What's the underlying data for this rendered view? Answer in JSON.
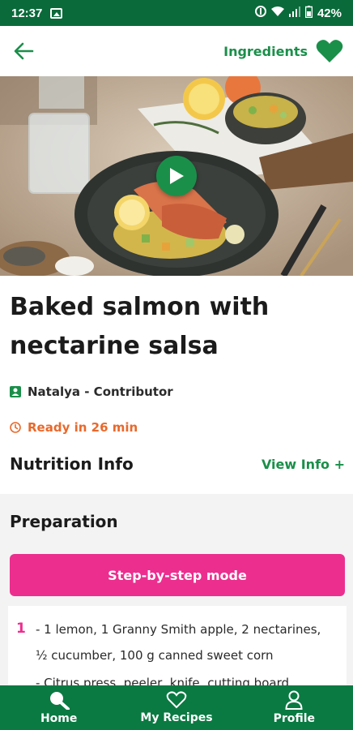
{
  "status_bar": {
    "time": "12:37",
    "battery": "42%"
  },
  "header": {
    "ingredients_label": "Ingredients"
  },
  "recipe": {
    "title": "Baked salmon with nectarine salsa",
    "author": "Natalya - Contributor",
    "ready_time": "Ready in 26 min"
  },
  "nutrition": {
    "title": "Nutrition Info",
    "view_label": "View Info +"
  },
  "preparation": {
    "title": "Preparation",
    "step_mode_label": "Step-by-step mode",
    "steps": [
      {
        "number": "1",
        "lines": [
          "- 1 lemon, 1 Granny Smith apple, 2 nectarines,",
          "½ cucumber, 100 g canned sweet corn",
          "- Citrus press, peeler, knife, cutting board"
        ]
      }
    ]
  },
  "bottom_nav": {
    "items": [
      {
        "label": "Home",
        "icon": "search-icon"
      },
      {
        "label": "My Recipes",
        "icon": "heart-icon"
      },
      {
        "label": "Profile",
        "icon": "person-icon"
      }
    ]
  },
  "colors": {
    "brand_green": "#1a8f4a",
    "status_green": "#0a6a3a",
    "nav_green": "#0a7a42",
    "accent_pink": "#ec2e8f",
    "time_orange": "#e8692c"
  }
}
